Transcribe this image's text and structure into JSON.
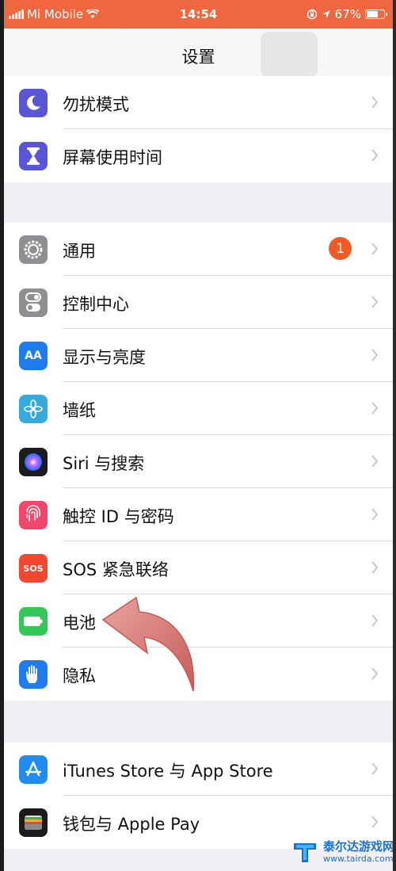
{
  "status_bar": {
    "carrier": "Mi Mobile",
    "time": "14:54",
    "battery": "67%"
  },
  "nav": {
    "title": "设置"
  },
  "group1": [
    {
      "label": "勿扰模式",
      "icon": "moon-icon",
      "color": "#5856d6"
    },
    {
      "label": "屏幕使用时间",
      "icon": "hourglass-icon",
      "color": "#5856d6"
    }
  ],
  "group2": [
    {
      "label": "通用",
      "icon": "gear-icon",
      "color": "#8e8e93",
      "badge": "1"
    },
    {
      "label": "控制中心",
      "icon": "toggles-icon",
      "color": "#8e8e93"
    },
    {
      "label": "显示与亮度",
      "icon": "text-size-icon",
      "icon_text": "AA",
      "color": "#1f7cf0"
    },
    {
      "label": "墙纸",
      "icon": "flower-icon",
      "color": "#35aadc"
    },
    {
      "label": "Siri 与搜索",
      "icon": "siri-icon",
      "color": "#1c1c1e"
    },
    {
      "label": "触控 ID 与密码",
      "icon": "fingerprint-icon",
      "color": "#f2466a"
    },
    {
      "label": "SOS 紧急联络",
      "icon": "sos-icon",
      "icon_text": "SOS",
      "color": "#f2462e"
    },
    {
      "label": "电池",
      "icon": "battery-icon",
      "color": "#34c759"
    },
    {
      "label": "隐私",
      "icon": "hand-icon",
      "color": "#1f7cf0"
    }
  ],
  "group3": [
    {
      "label": "iTunes Store 与 App Store",
      "icon": "app-store-icon",
      "color": "#1f8df0"
    },
    {
      "label": "钱包与 Apple Pay",
      "icon": "wallet-icon",
      "color": "#1c1c1e"
    }
  ],
  "watermark": {
    "name": "泰尔达游戏网",
    "url": "www.tairda.com"
  }
}
